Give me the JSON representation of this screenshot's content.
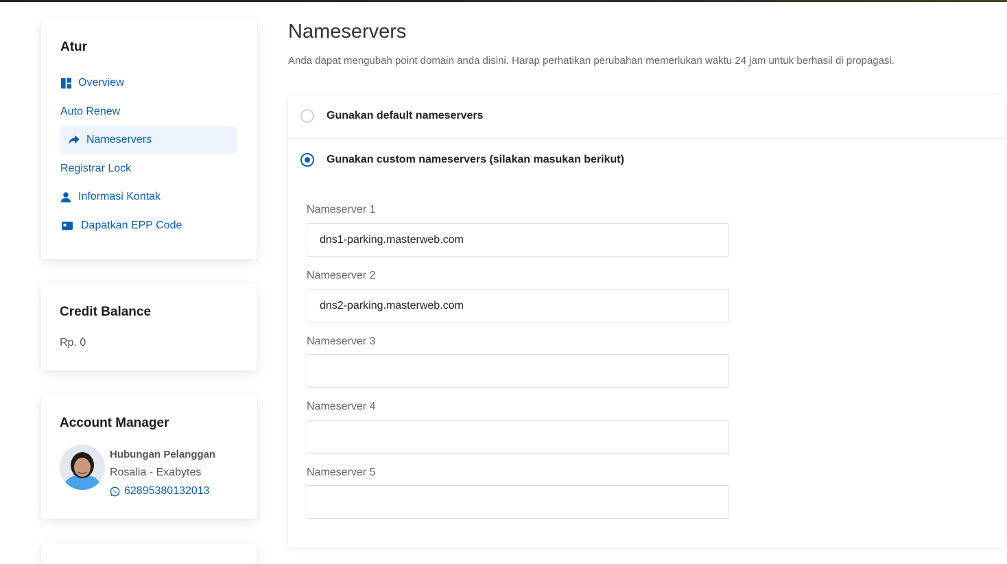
{
  "sidebar": {
    "atur": {
      "title": "Atur",
      "items": [
        {
          "label": "Overview",
          "icon": "dashboard-icon"
        },
        {
          "label": "Auto Renew",
          "icon": ""
        },
        {
          "label": "Nameservers",
          "icon": "share-arrow-icon",
          "active": true
        },
        {
          "label": "Registrar Lock",
          "icon": ""
        },
        {
          "label": "Informasi Kontak",
          "icon": "user-icon"
        },
        {
          "label": "Dapatkan EPP Code",
          "icon": "id-card-icon"
        }
      ]
    },
    "credit": {
      "title": "Credit Balance",
      "value": "Rp. 0"
    },
    "account_manager": {
      "title": "Account Manager",
      "name": "Hubungan Pelanggan",
      "subtitle": "Rosalia - Exabytes",
      "phone": "62895380132013"
    }
  },
  "main": {
    "title": "Nameservers",
    "description": "Anda dapat mengubah point domain anda disini. Harap perhatikan perubahan memerlukan waktu 24 jam untuk berhasil di propagasi.",
    "options": {
      "default_label": "Gunakan default nameservers",
      "custom_label": "Gunakan custom nameservers (silakan masukan berikut)",
      "selected": "custom"
    },
    "nameservers": [
      {
        "label": "Nameserver 1",
        "value": "dns1-parking.masterweb.com"
      },
      {
        "label": "Nameserver 2",
        "value": "dns2-parking.masterweb.com"
      },
      {
        "label": "Nameserver 3",
        "value": ""
      },
      {
        "label": "Nameserver 4",
        "value": ""
      },
      {
        "label": "Nameserver 5",
        "value": ""
      }
    ]
  },
  "colors": {
    "accent": "#0b5fb8",
    "active_bg": "#eef4fd"
  }
}
